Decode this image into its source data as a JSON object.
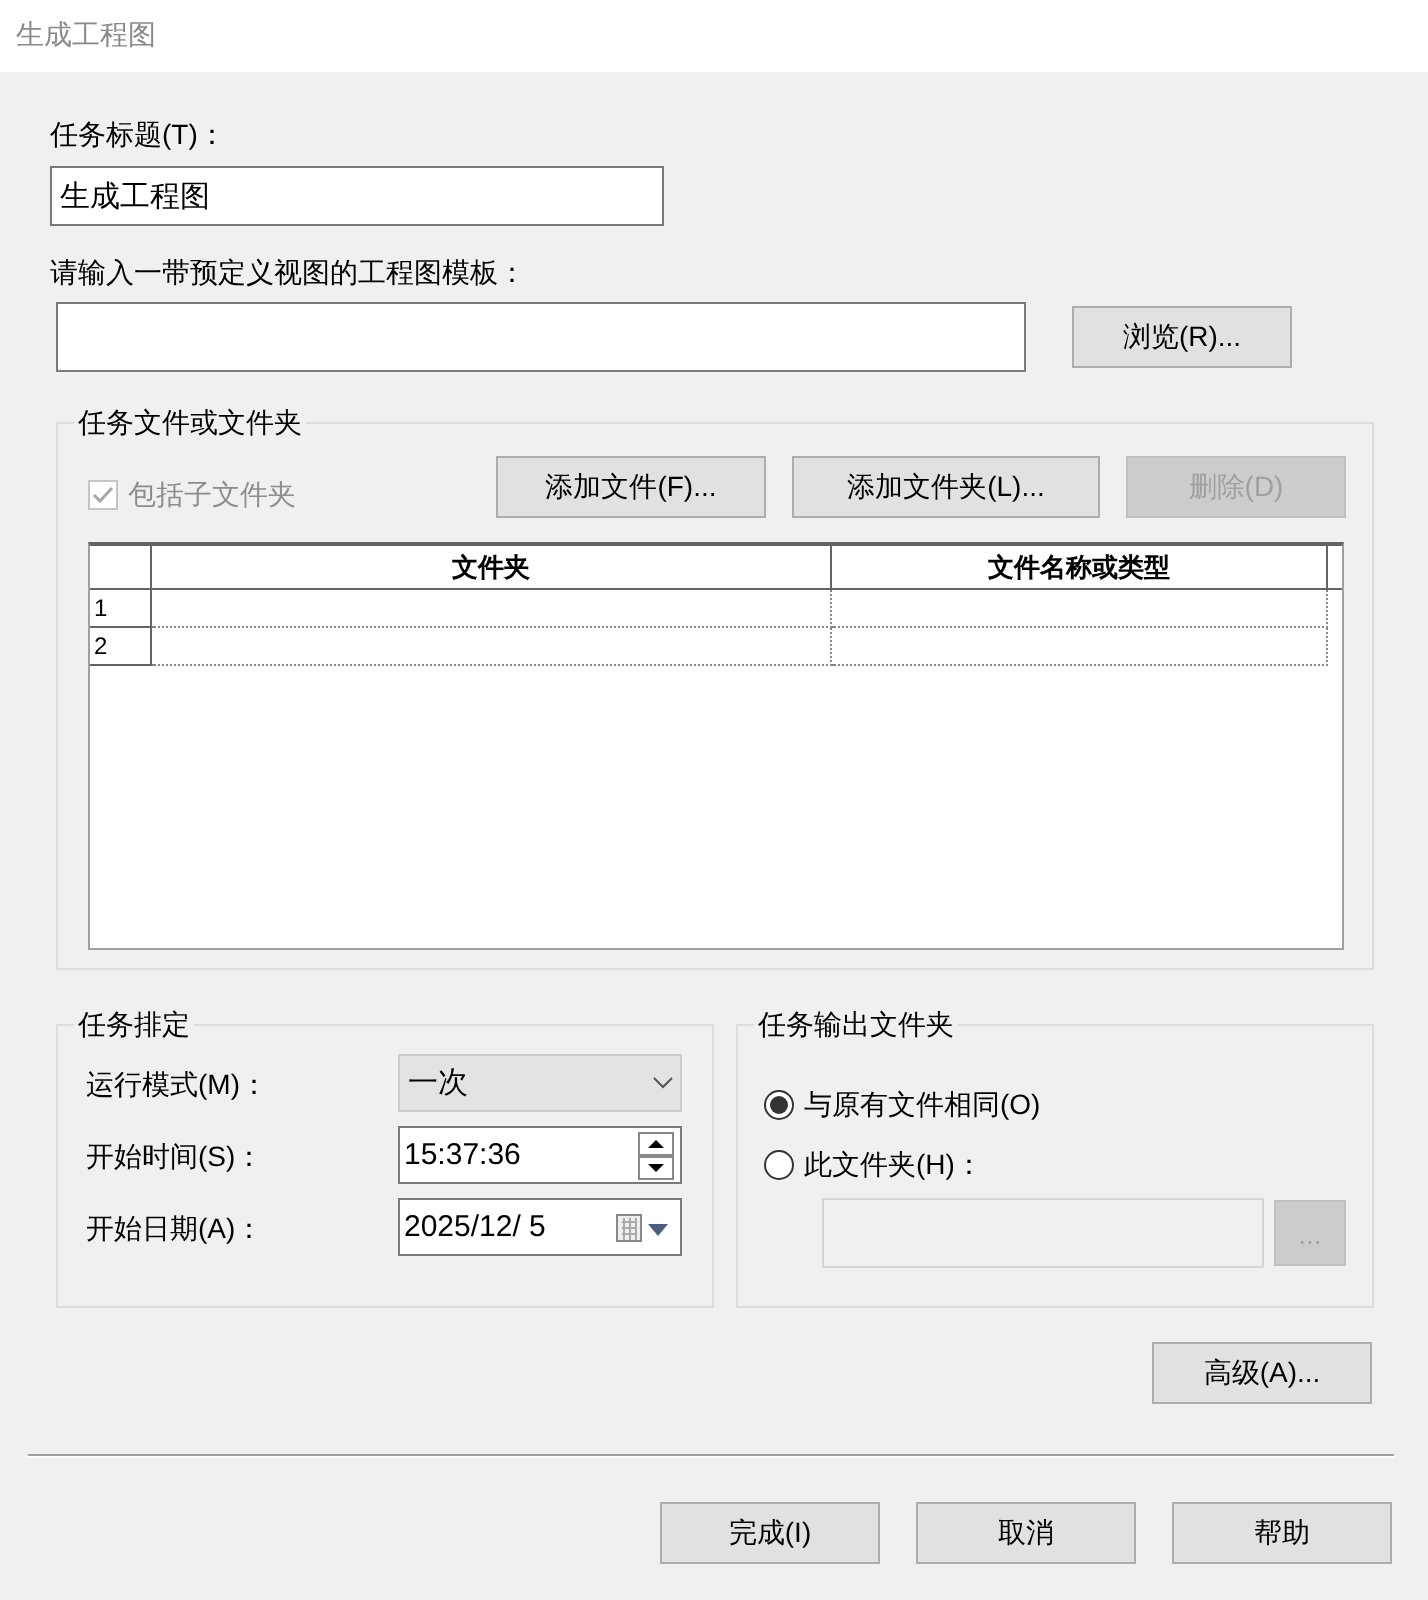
{
  "window": {
    "title": "生成工程图"
  },
  "task_title": {
    "label": "任务标题(T)：",
    "value": "生成工程图"
  },
  "template": {
    "label": "请输入一带预定义视图的工程图模板：",
    "browse": "浏览(R)..."
  },
  "files_group": {
    "title": "任务文件或文件夹",
    "include_subfolders": {
      "label": "包括子文件夹",
      "checked": true,
      "disabled": true
    },
    "buttons": [
      {
        "label": "添加文件(F)...",
        "disabled": false
      },
      {
        "label": "添加文件夹(L)...",
        "disabled": false
      },
      {
        "label": "删除(D)",
        "disabled": true
      }
    ],
    "table": {
      "columns": [
        "文件夹",
        "文件名称或类型"
      ],
      "row_numbers": [
        "1",
        "2"
      ]
    }
  },
  "schedule": {
    "title": "任务排定",
    "fields": [
      {
        "kind": "select",
        "label": "运行模式(M)：",
        "value": "一次"
      },
      {
        "kind": "time",
        "label": "开始时间(S)：",
        "value": "15:37:36"
      },
      {
        "kind": "date",
        "label": "开始日期(A)：",
        "value": "2025/12/  5"
      }
    ]
  },
  "output": {
    "title": "任务输出文件夹",
    "options": [
      {
        "label": "与原有文件相同(O)",
        "selected": true
      },
      {
        "label": "此文件夹(H)：",
        "selected": false
      }
    ],
    "folder_button": {
      "label": "...",
      "disabled": true
    }
  },
  "advanced": "高级(A)...",
  "footer_buttons": [
    "完成(I)",
    "取消",
    "帮助"
  ]
}
